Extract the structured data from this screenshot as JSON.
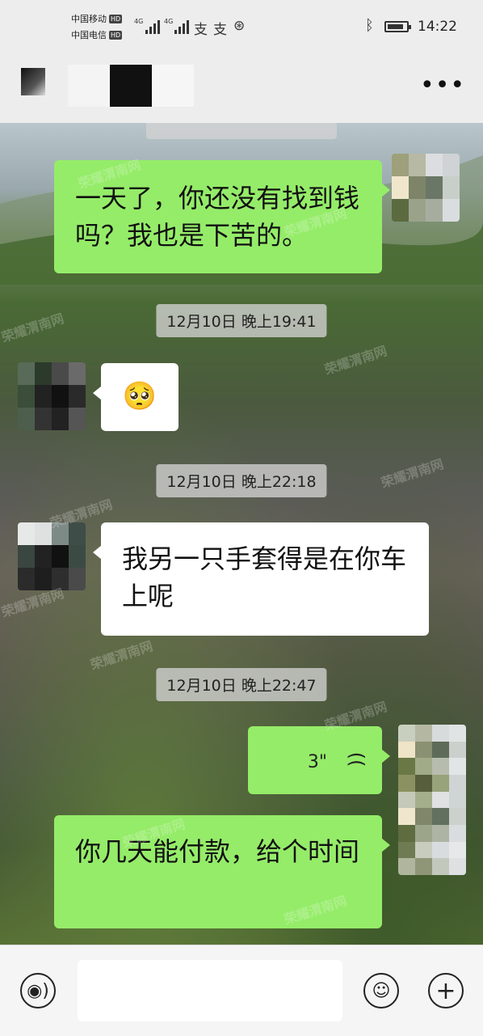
{
  "status_bar": {
    "carrier1": "中国移动",
    "carrier2": "中国电信",
    "hd": "HD",
    "net1": "4G",
    "net2": "4G",
    "pay_icons": [
      "alipay-icon",
      "alipay-icon",
      "chat-pay-icon"
    ],
    "bluetooth_icon": "bluetooth-icon",
    "battery_level": 0.85,
    "time": "14:22"
  },
  "title_bar": {
    "back_icon": "back-icon",
    "more_icon": "more-icon",
    "more_label": "•••"
  },
  "messages": [
    {
      "type": "timestamp",
      "text": ""
    },
    {
      "type": "text",
      "side": "right",
      "text": "一天了，你还没有找到钱吗？我也是下苦的。"
    },
    {
      "type": "timestamp",
      "text": "12月10日 晚上19:41"
    },
    {
      "type": "emoji",
      "side": "left",
      "text": "🥺"
    },
    {
      "type": "timestamp",
      "text": "12月10日 晚上22:18"
    },
    {
      "type": "text",
      "side": "left",
      "text": "我另一只手套得是在你车上呢"
    },
    {
      "type": "timestamp",
      "text": "12月10日 晚上22:47"
    },
    {
      "type": "voice",
      "side": "right",
      "duration": "3\""
    },
    {
      "type": "text",
      "side": "right",
      "text": "你几天能付款，给个时间"
    }
  ],
  "input_bar": {
    "voice_icon": "voice-icon",
    "emoji_icon": "emoji-icon",
    "plus_icon": "plus-icon",
    "voice_symbol": "◉)",
    "emoji_symbol": "☺",
    "plus_symbol": "+"
  },
  "watermark": "荣耀渭南网",
  "colors": {
    "outgoing_bubble": "#95ec69",
    "incoming_bubble": "#ffffff",
    "bar_bg": "#ededed"
  }
}
